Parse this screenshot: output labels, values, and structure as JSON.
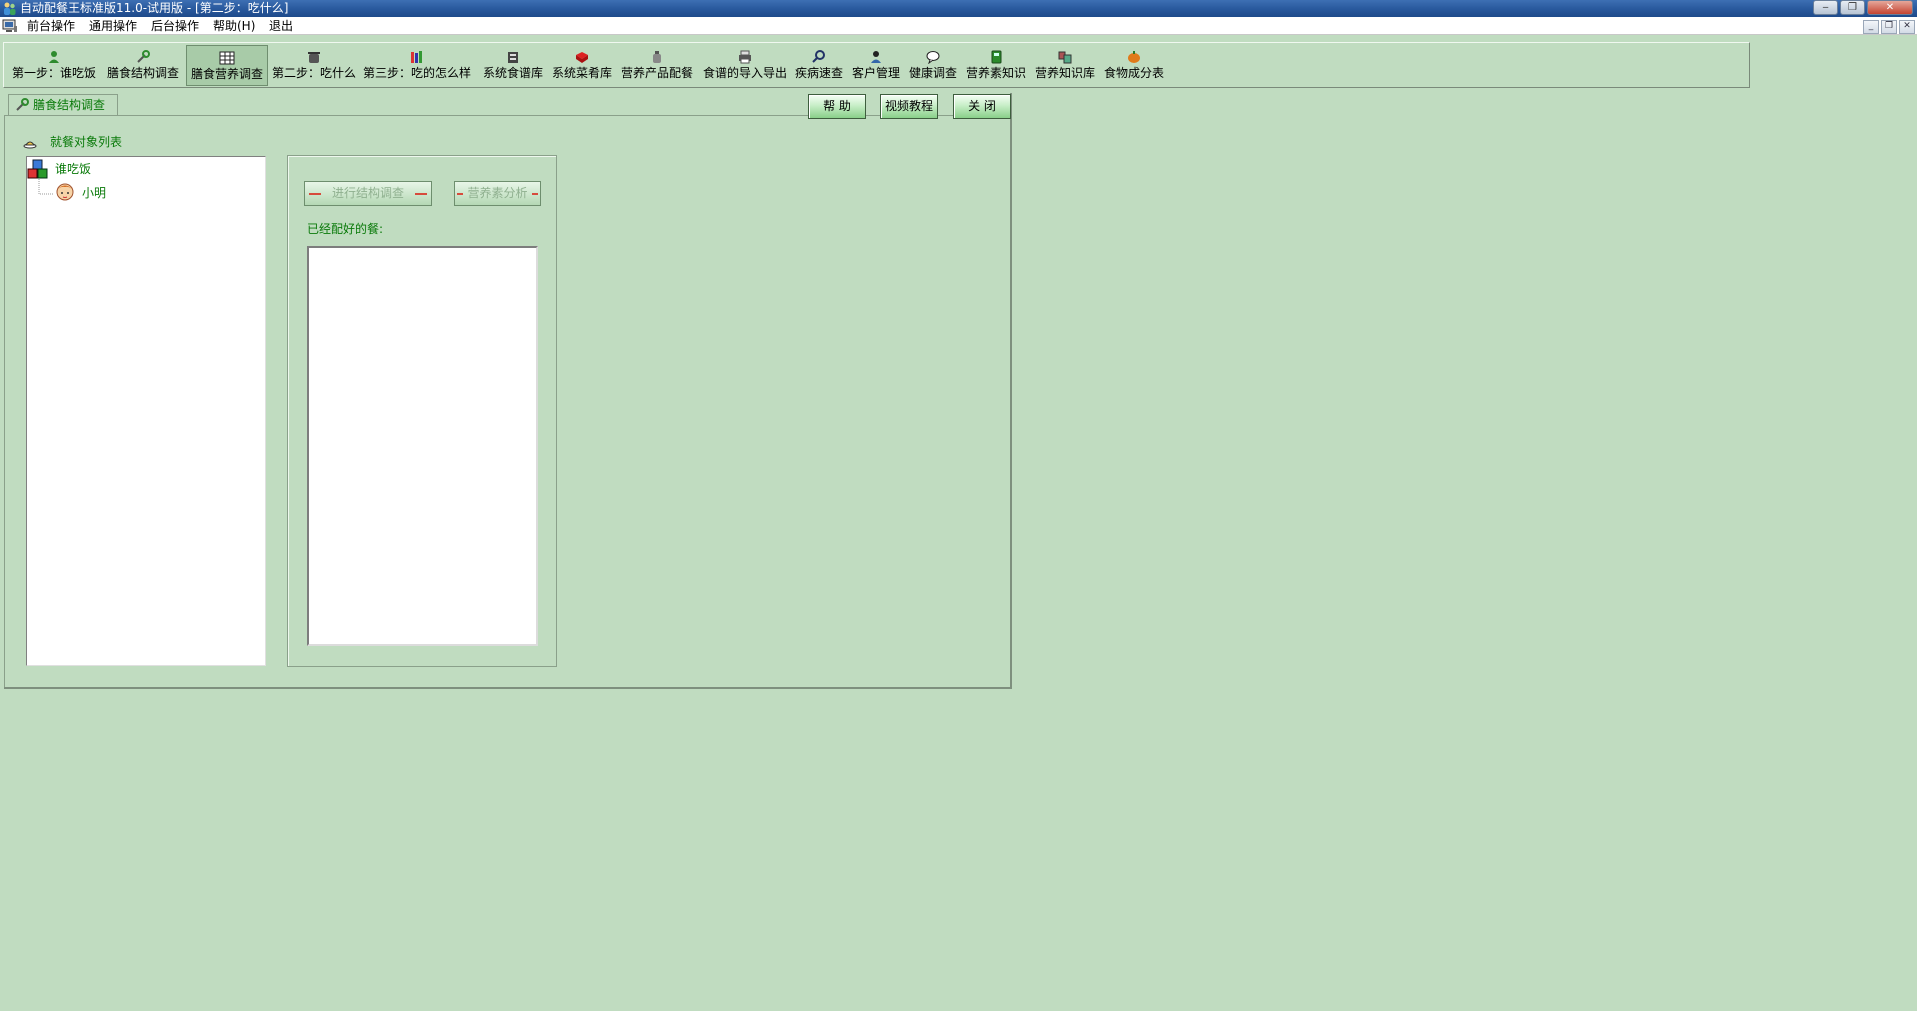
{
  "window": {
    "title": "自动配餐王标准版11.0-试用版 - [第二步：吃什么]",
    "controls": {
      "minimize": "‒",
      "restore": "❐",
      "close": "✕"
    }
  },
  "menu": {
    "items": [
      "前台操作",
      "通用操作",
      "后台操作",
      "帮助(H)",
      "退出"
    ],
    "mdi_controls": {
      "minimize": "_",
      "restore": "❐",
      "close": "✕"
    }
  },
  "toolbar": {
    "items": [
      {
        "label": "第一步：谁吃饭",
        "icon": "person-icon"
      },
      {
        "label": "膳食结构调查",
        "icon": "wrench-icon"
      },
      {
        "label": "膳食营养调查",
        "icon": "table-icon"
      },
      {
        "label": "第二步：吃什么",
        "icon": "pot-icon"
      },
      {
        "label": "第三步：吃的怎么样",
        "icon": "books-icon"
      },
      {
        "label": "系统食谱库",
        "icon": "database-icon"
      },
      {
        "label": "系统菜肴库",
        "icon": "book-icon"
      },
      {
        "label": "营养产品配餐",
        "icon": "bottle-icon"
      },
      {
        "label": "食谱的导入导出",
        "icon": "printer-icon"
      },
      {
        "label": "疾病速查",
        "icon": "search-icon"
      },
      {
        "label": "客户管理",
        "icon": "user-icon"
      },
      {
        "label": "健康调查",
        "icon": "speech-bubble-icon"
      },
      {
        "label": "营养素知识",
        "icon": "notebook-icon"
      },
      {
        "label": "营养知识库",
        "icon": "library-icon"
      },
      {
        "label": "食物成分表",
        "icon": "pumpkin-icon"
      }
    ],
    "active_index": 2
  },
  "child": {
    "tab_label": "膳食结构调查",
    "buttons": {
      "help": "帮 助",
      "video": "视频教程",
      "close": "关 闭"
    },
    "list_header": "就餐对象列表",
    "tree": {
      "root": "谁吃饭",
      "children": [
        "小明"
      ]
    },
    "actions": {
      "structure_survey": "进行结构调查",
      "nutrient_analysis": "营养素分析"
    },
    "meals_label": "已经配好的餐:",
    "meals": []
  },
  "colors": {
    "background": "#c0dcc0",
    "title_bar": "#2a5a9e",
    "accent_text": "#0a7a0a",
    "disabled_text": "#8fb08f",
    "disabled_mark": "#d74b3c"
  }
}
